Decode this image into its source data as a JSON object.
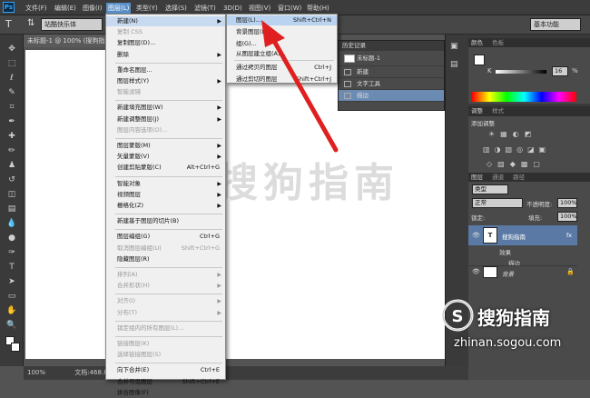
{
  "app": {
    "logo": "Ps"
  },
  "menubar": {
    "items": [
      "文件(F)",
      "编辑(E)",
      "图像(I)",
      "图层(L)",
      "类型(Y)",
      "选择(S)",
      "滤镜(T)",
      "3D(D)",
      "视图(V)",
      "窗口(W)",
      "帮助(H)"
    ]
  },
  "options": {
    "font_value": "站酷快乐体",
    "workspace": "基本功能"
  },
  "document": {
    "tab_title": "未标题-1 @ 100% (搜狗指南)",
    "zoom": "100%",
    "doc_info": "文档:468.8"
  },
  "watermark_center": "搜狗指南",
  "layer_menu": {
    "rows": [
      {
        "label": "新建(N)",
        "shortcut": "",
        "disabled": false,
        "submenu": true,
        "highlight": true
      },
      {
        "label": "复制 CSS",
        "shortcut": "",
        "disabled": true
      },
      {
        "label": "复制图层(D)...",
        "shortcut": "",
        "disabled": false
      },
      {
        "label": "删除",
        "shortcut": "",
        "disabled": false,
        "submenu": true
      },
      {
        "label": "重命名图层...",
        "shortcut": "",
        "disabled": false
      },
      {
        "label": "图层样式(Y)",
        "shortcut": "",
        "disabled": false,
        "submenu": true
      },
      {
        "label": "智能滤镜",
        "shortcut": "",
        "disabled": true
      },
      {
        "label": "新建填充图层(W)",
        "shortcut": "",
        "disabled": false,
        "submenu": true
      },
      {
        "label": "新建调整图层(J)",
        "shortcut": "",
        "disabled": false,
        "submenu": true
      },
      {
        "label": "图层内容选项(O)...",
        "shortcut": "",
        "disabled": true
      },
      {
        "label": "图层蒙版(M)",
        "shortcut": "",
        "disabled": false,
        "submenu": true
      },
      {
        "label": "矢量蒙版(V)",
        "shortcut": "",
        "disabled": false,
        "submenu": true
      },
      {
        "label": "创建剪贴蒙版(C)",
        "shortcut": "Alt+Ctrl+G",
        "disabled": false
      },
      {
        "label": "智能对象",
        "shortcut": "",
        "disabled": false,
        "submenu": true
      },
      {
        "label": "视频图层",
        "shortcut": "",
        "disabled": false,
        "submenu": true
      },
      {
        "label": "栅格化(Z)",
        "shortcut": "",
        "disabled": false,
        "submenu": true
      },
      {
        "label": "新建基于图层的切片(B)",
        "shortcut": "",
        "disabled": false
      },
      {
        "label": "图层编组(G)",
        "shortcut": "Ctrl+G",
        "disabled": false
      },
      {
        "label": "取消图层编组(U)",
        "shortcut": "Shift+Ctrl+G",
        "disabled": true
      },
      {
        "label": "隐藏图层(R)",
        "shortcut": "",
        "disabled": false
      },
      {
        "label": "排列(A)",
        "shortcut": "",
        "disabled": true,
        "submenu": true
      },
      {
        "label": "合并形状(H)",
        "shortcut": "",
        "disabled": true,
        "submenu": true
      },
      {
        "label": "对齐(I)",
        "shortcut": "",
        "disabled": true,
        "submenu": true
      },
      {
        "label": "分布(T)",
        "shortcut": "",
        "disabled": true,
        "submenu": true
      },
      {
        "label": "锁定组内的所有图层(L)...",
        "shortcut": "",
        "disabled": true
      },
      {
        "label": "链接图层(K)",
        "shortcut": "",
        "disabled": true
      },
      {
        "label": "选择链接图层(S)",
        "shortcut": "",
        "disabled": true
      },
      {
        "label": "向下合并(E)",
        "shortcut": "Ctrl+E",
        "disabled": false
      },
      {
        "label": "合并可见图层",
        "shortcut": "Shift+Ctrl+E",
        "disabled": false
      },
      {
        "label": "拼合图像(F)",
        "shortcut": "",
        "disabled": false
      }
    ]
  },
  "new_submenu": {
    "rows": [
      {
        "label": "图层(L)...",
        "shortcut": "Shift+Ctrl+N",
        "highlight": true
      },
      {
        "label": "背景图层(B)...",
        "shortcut": ""
      },
      {
        "label": "组(G)...",
        "shortcut": ""
      },
      {
        "label": "从图层建立组(A)...",
        "shortcut": ""
      },
      {
        "label": "通过拷贝的图层",
        "shortcut": "Ctrl+J"
      },
      {
        "label": "通过剪切的图层",
        "shortcut": "Shift+Ctrl+J"
      }
    ]
  },
  "history": {
    "title": "历史记录",
    "snapshot": "未标题-1",
    "rows": [
      "新建",
      "文字工具",
      "描边"
    ]
  },
  "panels": {
    "color_tab": "颜色",
    "swatches_tab": "色板",
    "k_label": "K",
    "k_value": "16",
    "k_unit": "%",
    "adjust_tab": "调整",
    "styles_tab": "样式",
    "adjust_title": "添加调整",
    "layers_tab": "图层",
    "channels_tab": "通道",
    "paths_tab": "路径",
    "kind_label": "类型",
    "blend_mode": "正常",
    "opacity_label": "不透明度:",
    "opacity_value": "100%",
    "lock_label": "锁定:",
    "fill_label": "填充:",
    "fill_value": "100%",
    "layers": [
      {
        "name": "搜狗指南",
        "type": "text",
        "fx": "fx"
      },
      {
        "name": "效果"
      },
      {
        "name": "描边"
      },
      {
        "name": "背景"
      }
    ]
  },
  "watermark": {
    "brand": "搜狗指南",
    "url": "zhinan.sogou.com"
  }
}
